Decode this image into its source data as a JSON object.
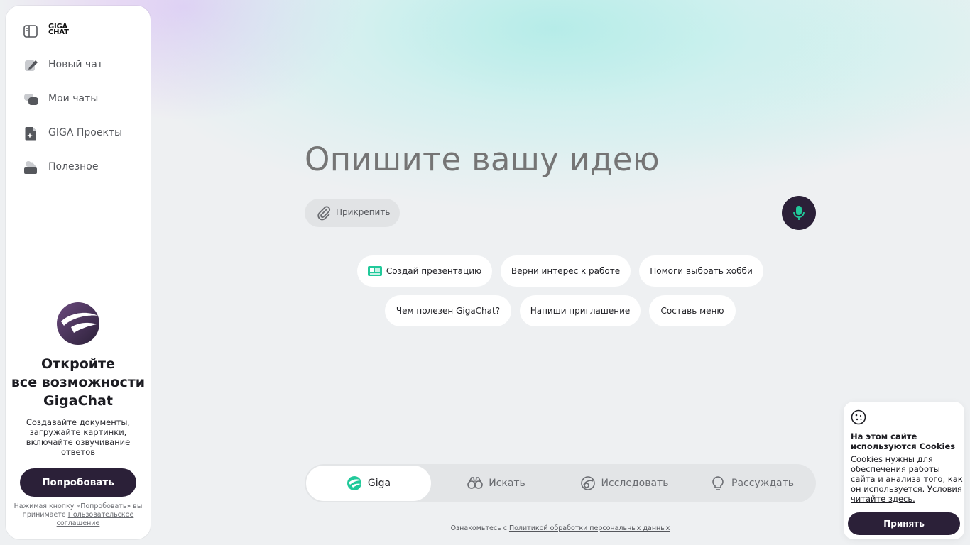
{
  "app": {
    "logo_line1": "GIGA",
    "logo_line2": "CHAT",
    "brand_dark": "#2b2038",
    "accent": "#21c99a"
  },
  "sidebar": {
    "toggle_icon": "sidebar-toggle-icon",
    "items": [
      {
        "label": "Новый чат",
        "icon": "edit-icon"
      },
      {
        "label": "Мои чаты",
        "icon": "chats-icon"
      },
      {
        "label": "GIGA Проекты",
        "icon": "projects-icon"
      },
      {
        "label": "Полезное",
        "icon": "useful-icon"
      }
    ],
    "promo": {
      "title_l1": "Откройте",
      "title_l2": "все возможности",
      "title_l3": "GigaChat",
      "text": "Создавайте документы, загружайте картинки, включайте озвучивание ответов",
      "button": "Попробовать",
      "legal_prefix": "Нажимая кнопку «Попробовать» вы принимаете",
      "legal_link": "Пользовательское соглашение"
    }
  },
  "main": {
    "prompt_placeholder": "Опишите вашу идею",
    "attach_label": "Прикрепить",
    "suggestions": [
      "Создай презентацию",
      "Верни интерес к работе",
      "Помоги выбрать хобби",
      "Чем полезен GigaChat?",
      "Напиши приглашение",
      "Составь меню"
    ],
    "modes": [
      {
        "label": "Giga",
        "icon": "giga-icon",
        "active": true
      },
      {
        "label": "Искать",
        "icon": "search-binoculars-icon",
        "active": false
      },
      {
        "label": "Исследовать",
        "icon": "research-icon",
        "active": false
      },
      {
        "label": "Рассуждать",
        "icon": "lightbulb-icon",
        "active": false
      }
    ],
    "footer_prefix": "Ознакомьтесь с",
    "footer_link": "Политикой обработки персональных данных"
  },
  "cookie": {
    "title": "На этом сайте используются Cookies",
    "text": "Cookies нужны для обеспечения работы сайта и анализа того, как он используется. Условия",
    "link": "читайте здесь.",
    "button": "Принять"
  }
}
